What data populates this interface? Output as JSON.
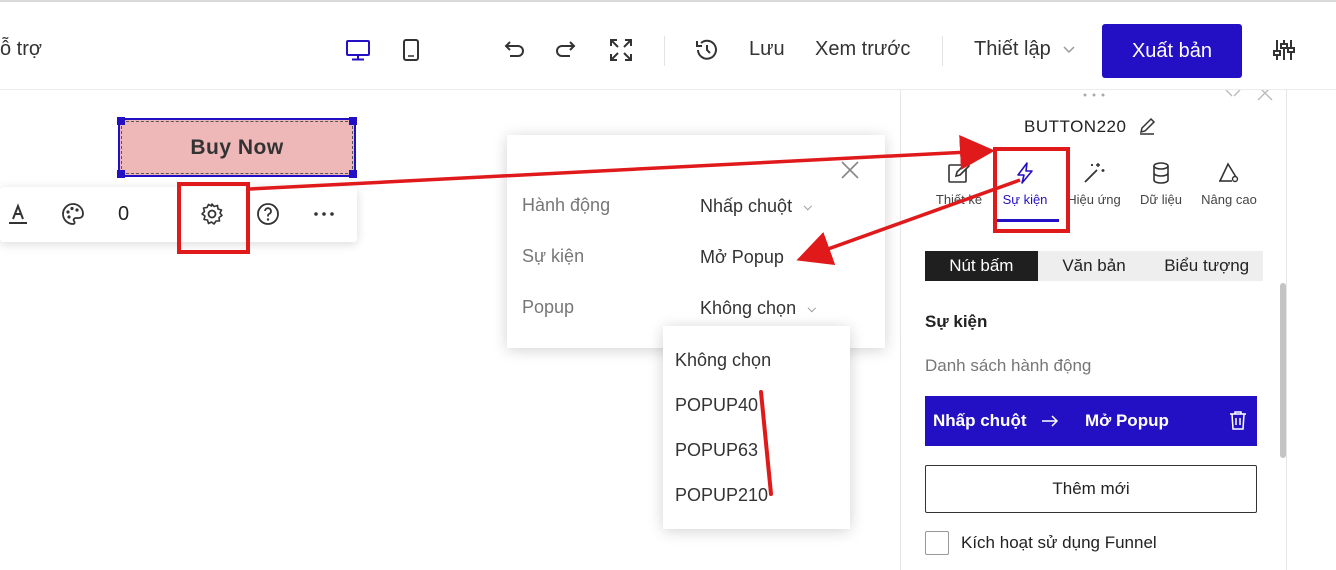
{
  "topbar": {
    "support_label": "ỗ trợ",
    "save_label": "Lưu",
    "preview_label": "Xem trước",
    "settings_label": "Thiết lập",
    "publish_label": "Xuất bản"
  },
  "canvas": {
    "buy_button_label": "Buy Now",
    "toolbar_counter": "0"
  },
  "popover": {
    "rows": [
      {
        "label": "Hành động",
        "value": "Nhấp chuột"
      },
      {
        "label": "Sự kiện",
        "value": "Mở Popup"
      },
      {
        "label": "Popup",
        "value": "Không chọn"
      }
    ]
  },
  "dropdown": {
    "options": [
      "Không chọn",
      "POPUP40",
      "POPUP63",
      "POPUP210"
    ]
  },
  "panel": {
    "element_name": "BUTTON220",
    "tabs": [
      "Thiết kế",
      "Sự kiện",
      "Hiệu ứng",
      "Dữ liệu",
      "Nâng cao"
    ],
    "active_tab": "Sự kiện",
    "segments": [
      "Nút bấm",
      "Văn bản",
      "Biểu tượng"
    ],
    "active_segment": "Nút bấm",
    "section_title": "Sự kiện",
    "section_subtitle": "Danh sách hành động",
    "action": {
      "trigger": "Nhấp chuột",
      "result": "Mở Popup"
    },
    "add_label": "Thêm mới",
    "funnel_label": "Kích hoạt sử dụng Funnel"
  },
  "colors": {
    "accent": "#2410c4",
    "highlight_red": "#e0191b",
    "buy_button_bg": "#efb8b8"
  },
  "icons": [
    "desktop-icon",
    "tablet-icon",
    "undo-icon",
    "redo-icon",
    "fullscreen-icon",
    "history-icon",
    "chevron-down-icon",
    "sliders-icon",
    "text-color-icon",
    "palette-icon",
    "gear-icon",
    "help-icon",
    "more-icon",
    "close-icon",
    "pencil-icon",
    "lightning-icon",
    "magic-wand-icon",
    "database-icon",
    "advanced-settings-icon",
    "trash-icon",
    "arrow-right-icon"
  ]
}
